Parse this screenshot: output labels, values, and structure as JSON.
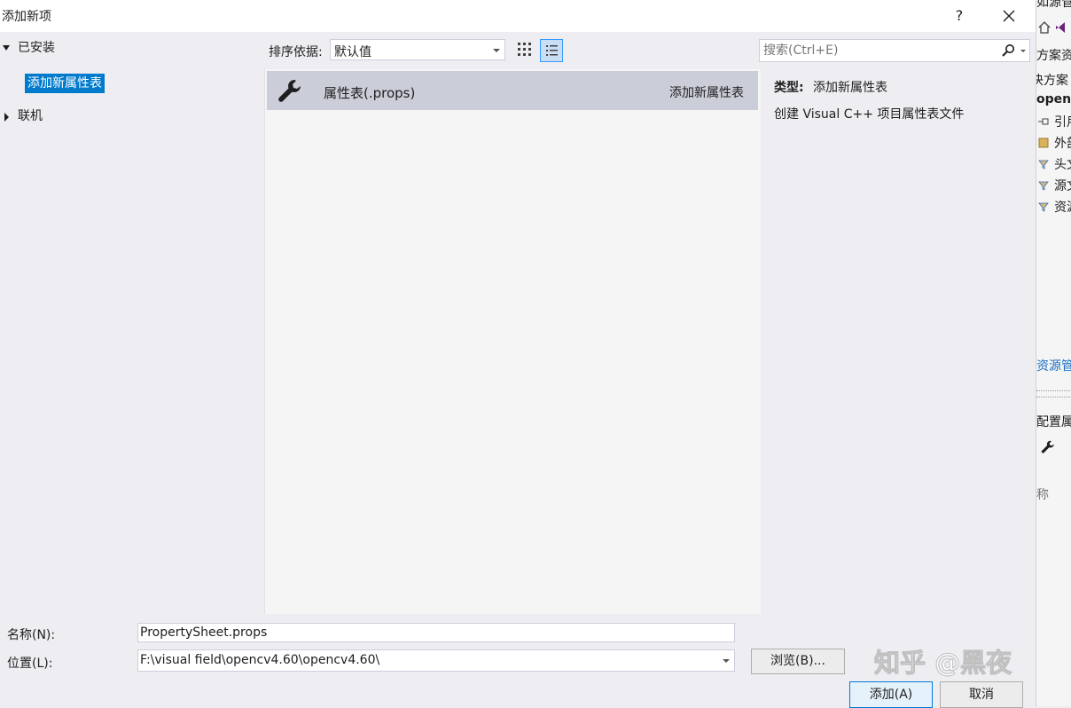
{
  "dialog": {
    "title": "添加新项",
    "help_label": "?"
  },
  "tree": {
    "installed": "已安装",
    "selected_item": "添加新属性表",
    "online": "联机"
  },
  "toolbar": {
    "sort_label": "排序依据:",
    "sort_value": "默认值"
  },
  "templates": [
    {
      "name": "属性表(.props)",
      "category": "添加新属性表"
    }
  ],
  "search": {
    "placeholder": "搜索(Ctrl+E)"
  },
  "details": {
    "type_label": "类型:",
    "type_value": "添加新属性表",
    "description": "创建 Visual C++ 项目属性表文件"
  },
  "form": {
    "name_label": "名称(N):",
    "name_value": "PropertySheet.props",
    "location_label": "位置(L):",
    "location_value": "F:\\visual field\\opencv4.60\\opencv4.60\\",
    "browse_label": "浏览(B)...",
    "add_label": "添加(A)",
    "cancel_label": "取消"
  },
  "background": {
    "t0": "如源管",
    "t1": "方案资",
    "t2": "决方案",
    "t3": "openc",
    "t4": "引用",
    "t5": "外部",
    "t6": "头文",
    "t7": "源文",
    "t8": "资源",
    "t9": "资源管",
    "t10": "配置属",
    "t11": "称"
  },
  "watermark": "知乎 @黑夜",
  "colors": {
    "selection_blue": "#007acc",
    "template_highlight": "#cbcdd8",
    "vs_purple": "#68217a"
  }
}
